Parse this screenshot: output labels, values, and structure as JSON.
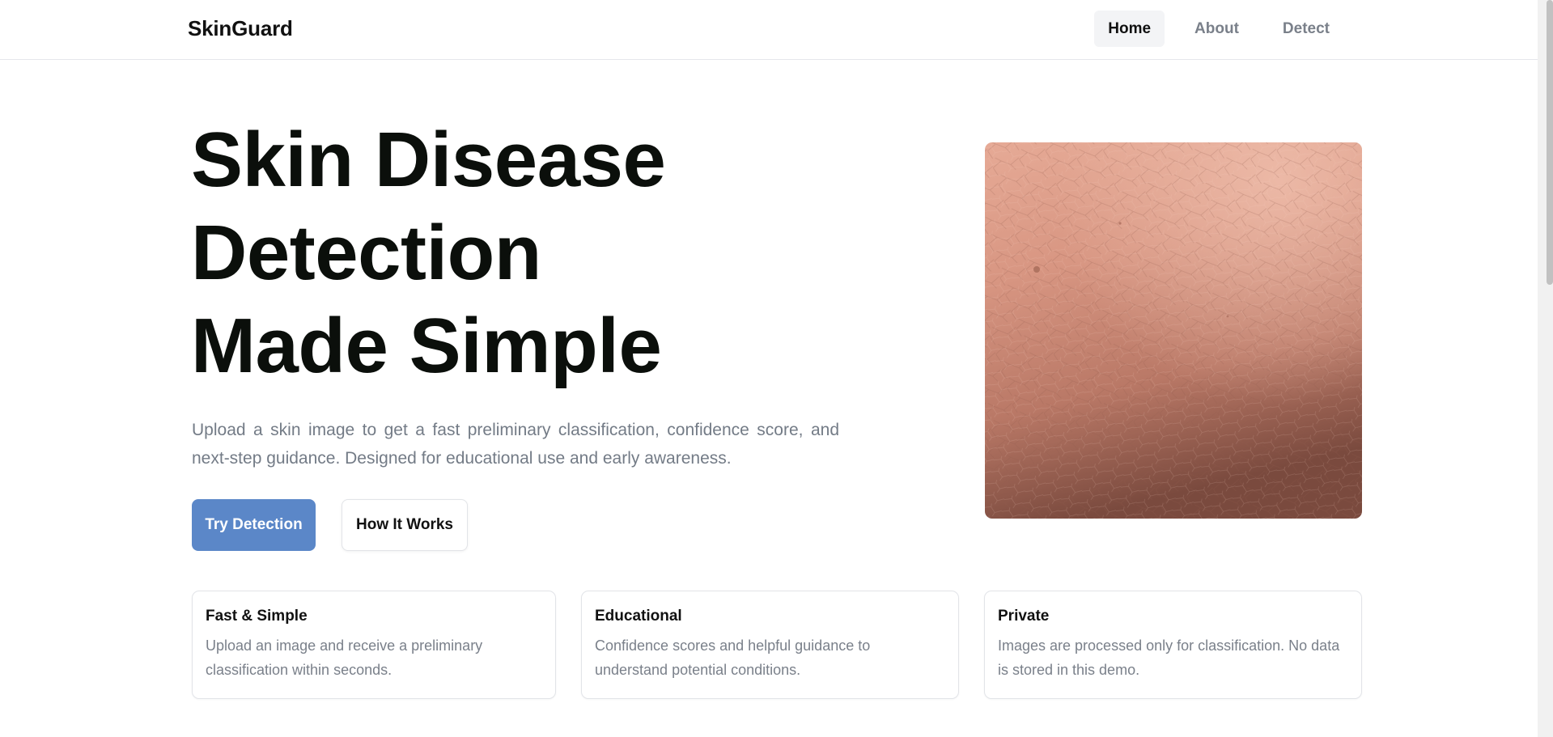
{
  "header": {
    "brand": "SkinGuard",
    "nav": [
      {
        "label": "Home",
        "active": true
      },
      {
        "label": "About",
        "active": false
      },
      {
        "label": "Detect",
        "active": false
      }
    ]
  },
  "hero": {
    "title_lines": [
      "Skin Disease",
      "Detection",
      "Made Simple"
    ],
    "subtitle": "Upload a skin image to get a fast preliminary classification, confidence score, and next-step guidance. Designed for educational use and early awareness.",
    "primary_button": "Try Detection",
    "secondary_button": "How It Works",
    "image": "close-up photo of skin texture"
  },
  "features": [
    {
      "title": "Fast & Simple",
      "text": "Upload an image and receive a preliminary classification within seconds."
    },
    {
      "title": "Educational",
      "text": "Confidence scores and helpful guidance to understand potential conditions."
    },
    {
      "title": "Private",
      "text": "Images are processed only for classification. No data is stored in this demo."
    }
  ],
  "colors": {
    "accent": "#5b87c8",
    "text": "#0b0f0b",
    "muted": "#737b86"
  }
}
